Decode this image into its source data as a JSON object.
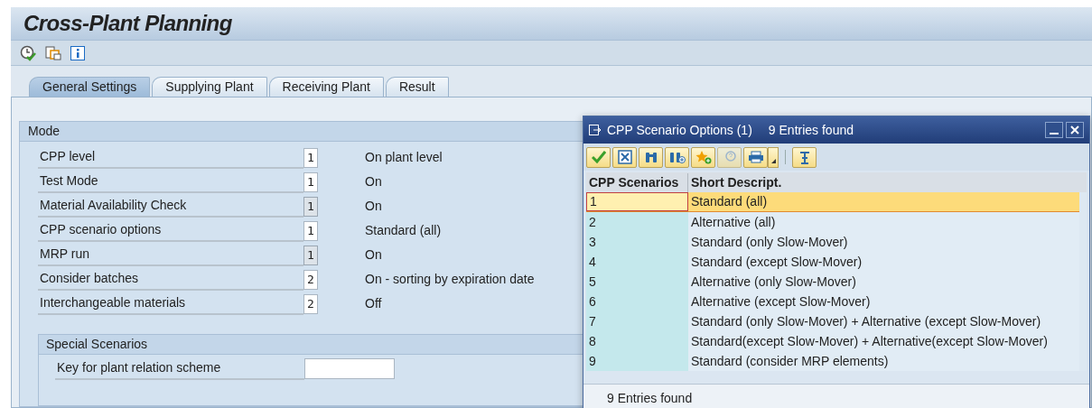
{
  "title": "Cross-Plant Planning",
  "tabs": [
    {
      "label": "General Settings",
      "selected": true
    },
    {
      "label": "Supplying Plant",
      "selected": false
    },
    {
      "label": "Receiving Plant",
      "selected": false
    },
    {
      "label": "Result",
      "selected": false
    }
  ],
  "mode": {
    "title": "Mode",
    "rows": [
      {
        "label": "CPP level",
        "value": "1",
        "disabled": false,
        "description": "On plant level"
      },
      {
        "label": "Test Mode",
        "value": "1",
        "disabled": false,
        "description": "On"
      },
      {
        "label": "Material Availability Check",
        "value": "1",
        "disabled": true,
        "description": "On"
      },
      {
        "label": "CPP scenario options",
        "value": "1",
        "disabled": false,
        "description": "Standard (all)"
      },
      {
        "label": "MRP run",
        "value": "1",
        "disabled": true,
        "description": "On"
      },
      {
        "label": "Consider batches",
        "value": "2",
        "disabled": false,
        "description": "On - sorting by expiration date"
      },
      {
        "label": "Interchangeable materials",
        "value": "2",
        "disabled": false,
        "description": "Off"
      }
    ]
  },
  "special": {
    "title": "Special Scenarios",
    "key_label": "Key for plant relation scheme"
  },
  "dialog": {
    "title": "CPP Scenario Options (1)",
    "count": "9 Entries found",
    "columns": [
      "CPP Scenarios",
      "Short Descript."
    ],
    "rows": [
      {
        "code": "1",
        "text": "Standard (all)",
        "selected": true
      },
      {
        "code": "2",
        "text": "Alternative (all)",
        "selected": false
      },
      {
        "code": "3",
        "text": "Standard (only Slow-Mover)",
        "selected": false
      },
      {
        "code": "4",
        "text": "Standard (except Slow-Mover)",
        "selected": false
      },
      {
        "code": "5",
        "text": "Alternative (only Slow-Mover)",
        "selected": false
      },
      {
        "code": "6",
        "text": "Alternative (except Slow-Mover)",
        "selected": false
      },
      {
        "code": "7",
        "text": "Standard (only Slow-Mover) + Alternative (except Slow-Mover)",
        "selected": false
      },
      {
        "code": "8",
        "text": "Standard(except Slow-Mover) + Alternative(except Slow-Mover)",
        "selected": false
      },
      {
        "code": "9",
        "text": "Standard (consider MRP elements)",
        "selected": false
      }
    ],
    "status": "9 Entries found"
  }
}
